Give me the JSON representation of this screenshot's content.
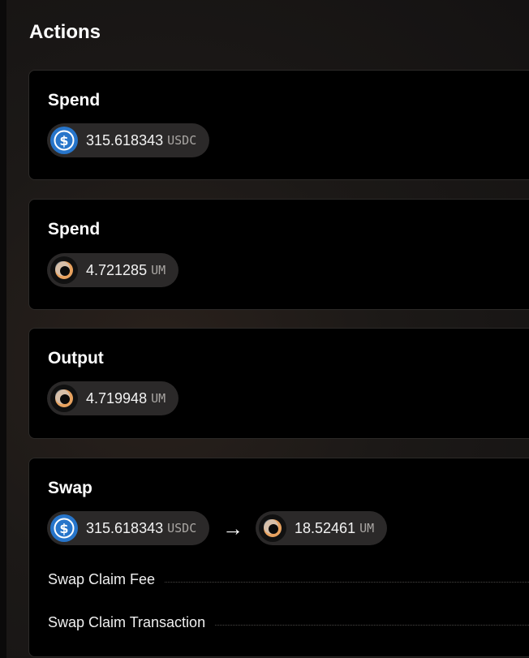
{
  "page": {
    "heading": "Actions"
  },
  "actions": [
    {
      "title": "Spend",
      "value": {
        "amount": "315.618343",
        "symbol": "USDC",
        "icon": "usdc-icon"
      }
    },
    {
      "title": "Spend",
      "value": {
        "amount": "4.721285",
        "symbol": "UM",
        "icon": "penumbra-icon"
      }
    },
    {
      "title": "Output",
      "value": {
        "amount": "4.719948",
        "symbol": "UM",
        "icon": "penumbra-icon"
      }
    },
    {
      "title": "Swap",
      "input": {
        "amount": "315.618343",
        "symbol": "USDC",
        "icon": "usdc-icon"
      },
      "arrow": "→",
      "output": {
        "amount": "18.52461",
        "symbol": "UM",
        "icon": "penumbra-icon"
      },
      "rows": [
        {
          "label": "Swap Claim Fee"
        },
        {
          "label": "Swap Claim Transaction"
        }
      ]
    }
  ],
  "colors": {
    "usdc": "#2775ca",
    "penumbra_ring": "#e8a25f",
    "pill_bg": "#2b2929",
    "card_bg": "#000000"
  }
}
